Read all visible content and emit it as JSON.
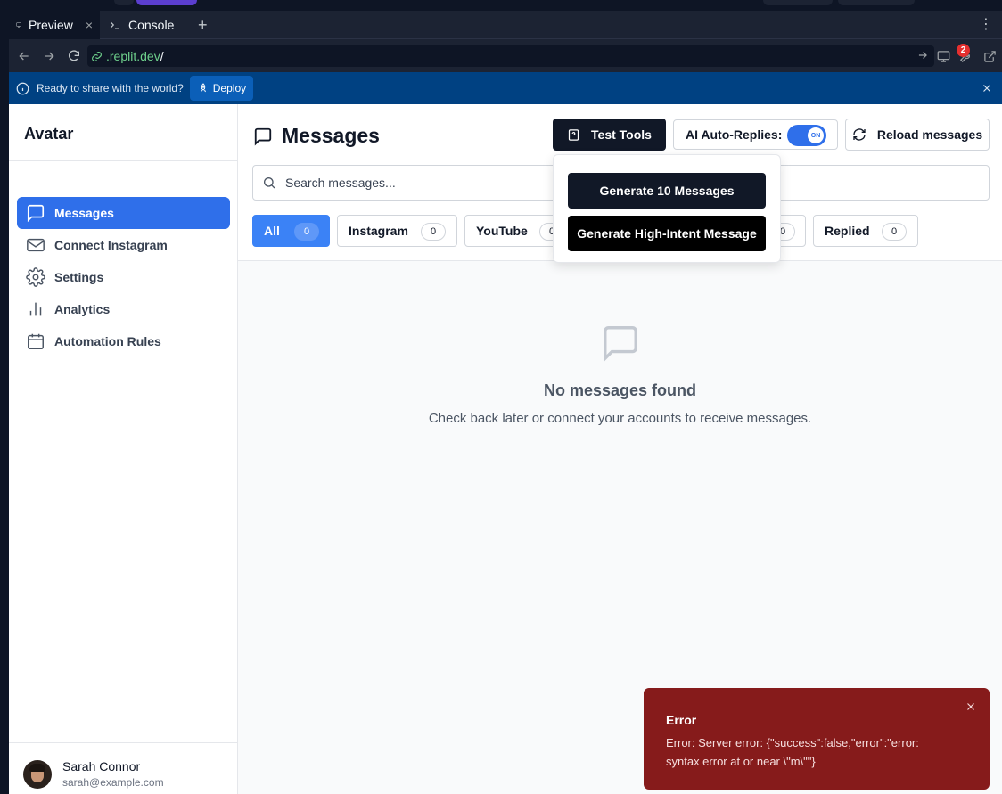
{
  "browser": {
    "tabs": [
      {
        "label": "Preview",
        "close": "×"
      },
      {
        "label": "Console"
      }
    ],
    "add_tab": "+",
    "more": "⋮",
    "url": {
      "host": ".replit.dev",
      "path": "/"
    },
    "badge_count": "2"
  },
  "deploy_banner": {
    "text": "Ready to share with the world?",
    "button": "Deploy"
  },
  "sidebar": {
    "brand": "Avatar",
    "items": [
      {
        "label": "Messages",
        "icon": "message-square-icon",
        "active": true
      },
      {
        "label": "Connect Instagram",
        "icon": "mail-icon"
      },
      {
        "label": "Settings",
        "icon": "gear-icon"
      },
      {
        "label": "Analytics",
        "icon": "bar-chart-icon"
      },
      {
        "label": "Automation Rules",
        "icon": "calendar-icon"
      }
    ],
    "user": {
      "name": "Sarah Connor",
      "email": "sarah@example.com"
    }
  },
  "header": {
    "title": "Messages",
    "test_tools": "Test Tools",
    "auto_replies": {
      "label": "AI Auto-Replies:",
      "state": "ON"
    },
    "reload": "Reload messages"
  },
  "search": {
    "placeholder": "Search messages..."
  },
  "filters": [
    {
      "label": "All",
      "count": "0",
      "active": true
    },
    {
      "label": "Instagram",
      "count": "0"
    },
    {
      "label": "YouTube",
      "count": "0"
    },
    {
      "label": "",
      "count": "0"
    },
    {
      "label": "Replied",
      "count": "0"
    }
  ],
  "dropdown": {
    "generate_10": "Generate 10 Messages",
    "generate_high_intent": "Generate High-Intent Message"
  },
  "empty_state": {
    "title": "No messages found",
    "subtitle": "Check back later or connect your accounts to receive messages."
  },
  "toast": {
    "title": "Error",
    "message": "Error: Server error: {\"success\":false,\"error\":\"error: syntax error at or near \\\"m\\\"\"}"
  },
  "colors": {
    "accent": "#2f6fea",
    "chip_active": "#3b82f6",
    "toast_bg": "#861b1b",
    "deploy_bar": "#004182"
  }
}
